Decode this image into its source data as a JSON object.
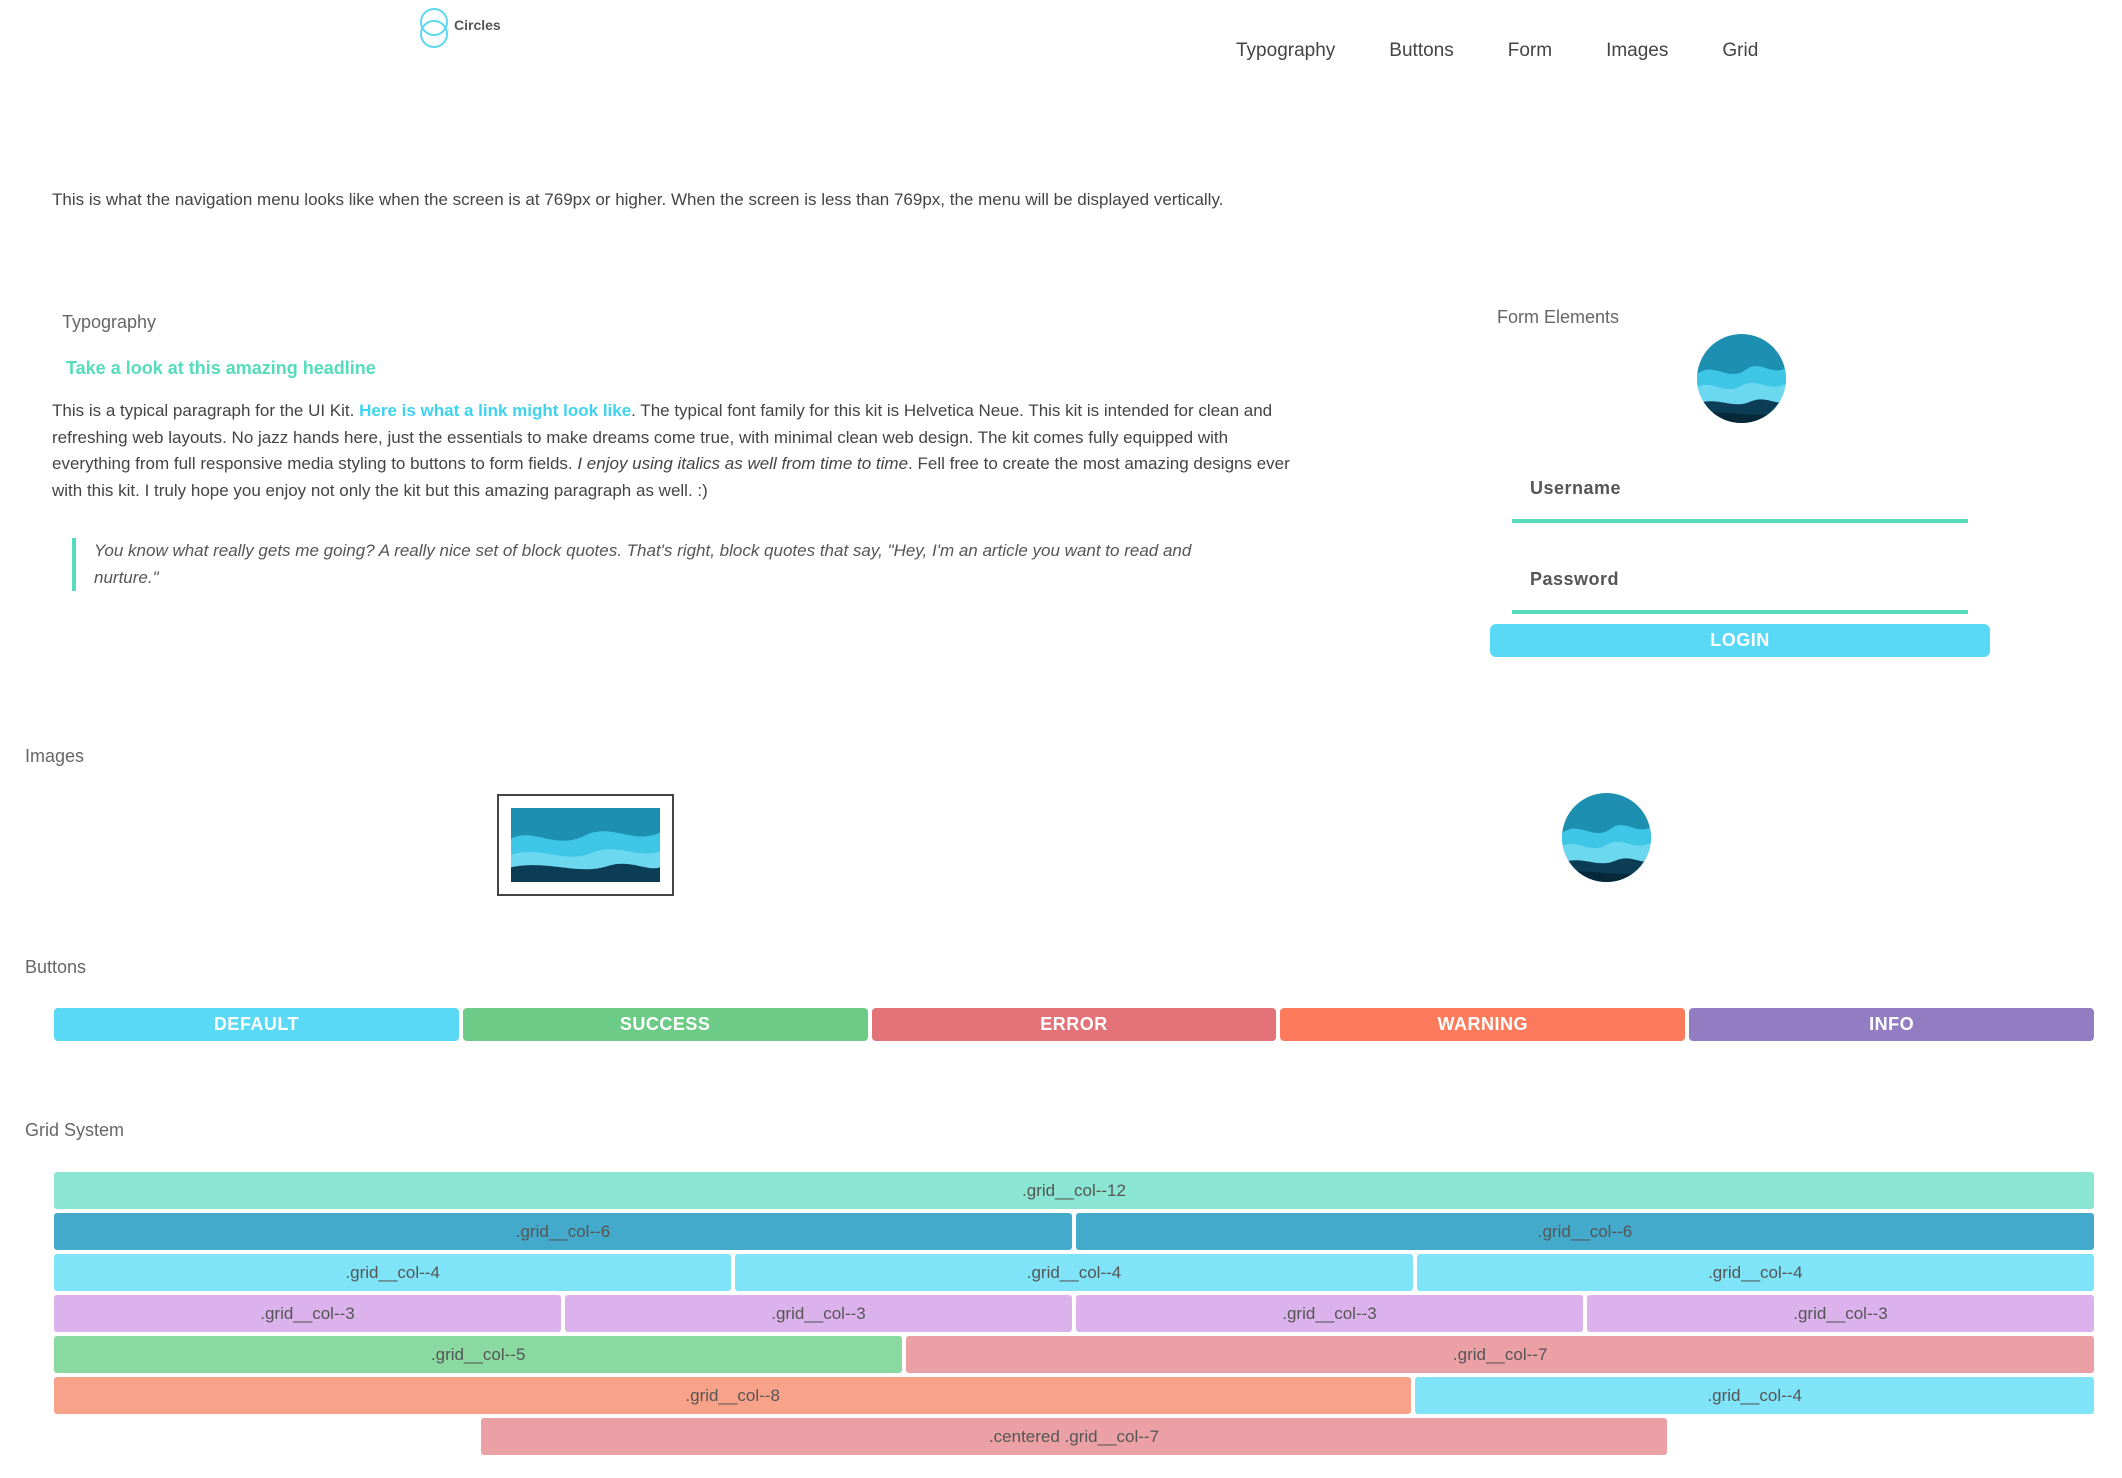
{
  "header": {
    "logo_text": "Circles",
    "nav": [
      {
        "label": "Typography"
      },
      {
        "label": "Buttons"
      },
      {
        "label": "Form"
      },
      {
        "label": "Images"
      },
      {
        "label": "Grid"
      }
    ]
  },
  "intro": "This is what the navigation menu looks like when the screen is at 769px or higher. When the screen is less than 769px, the menu will be displayed vertically.",
  "typography": {
    "label": "Typography",
    "headline": "Take a look at this amazing headline",
    "p_before": "This is a typical paragraph for the UI Kit. ",
    "link": "Here is what a link might look like",
    "p_middle": ". The typical font family for this kit is Helvetica Neue. This kit is intended for clean and refreshing web layouts. No jazz hands here, just the essentials to make dreams come true, with minimal clean web design. The kit comes fully equipped with everything from full responsive media styling to buttons to form fields. ",
    "italic": "I enjoy using italics as well from time to time",
    "p_after": ". Fell free to create the most amazing designs ever with this kit. I truly hope you enjoy not only the kit but this amazing paragraph as well. :)",
    "blockquote": "You know what really gets me going? A really nice set of block quotes. That's right, block quotes that say, \"Hey, I'm an article you want to read and nurture.\""
  },
  "form": {
    "label": "Form Elements",
    "username_placeholder": "Username",
    "password_placeholder": "Password",
    "login_label": "LOGIN"
  },
  "images": {
    "label": "Images"
  },
  "buttons": {
    "label": "Buttons",
    "items": [
      {
        "label": "DEFAULT",
        "color": "#5ad9f7"
      },
      {
        "label": "SUCCESS",
        "color": "#6ccb87"
      },
      {
        "label": "ERROR",
        "color": "#e37378"
      },
      {
        "label": "WARNING",
        "color": "#fd7b5c"
      },
      {
        "label": "INFO",
        "color": "#937dc2"
      }
    ]
  },
  "grid": {
    "label": "Grid System",
    "rows": [
      [
        {
          "label": ".grid__col--12",
          "color": "#8ae6d3"
        }
      ],
      [
        {
          "label": ".grid__col--6",
          "color": "#44aacb"
        },
        {
          "label": ".grid__col--6",
          "color": "#44aacb"
        }
      ],
      [
        {
          "label": ".grid__col--4",
          "color": "#7fe4f8"
        },
        {
          "label": ".grid__col--4",
          "color": "#7fe4f8"
        },
        {
          "label": ".grid__col--4",
          "color": "#7fe4f8"
        }
      ],
      [
        {
          "label": ".grid__col--3",
          "color": "#dbb2ec"
        },
        {
          "label": ".grid__col--3",
          "color": "#dbb2ec"
        },
        {
          "label": ".grid__col--3",
          "color": "#dbb2ec"
        },
        {
          "label": ".grid__col--3",
          "color": "#dbb2ec"
        }
      ],
      [
        {
          "label": ".grid__col--5",
          "color": "#8ad9a1"
        },
        {
          "label": ".grid__col--7",
          "color": "#eaa0a5"
        }
      ],
      [
        {
          "label": ".grid__col--8",
          "color": "#f9a28a"
        },
        {
          "label": ".grid__col--4",
          "color": "#7fe4f8"
        }
      ],
      [
        {
          "label": ".centered .grid__col--7",
          "color": "#eaa0a5"
        }
      ]
    ]
  }
}
